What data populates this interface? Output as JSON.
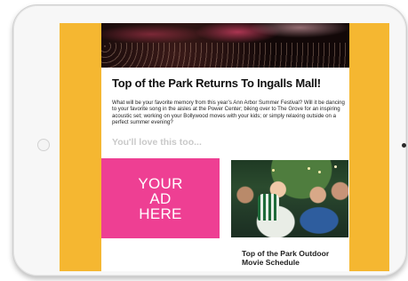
{
  "article": {
    "headline": "Top of the Park Returns To Ingalls Mall!",
    "intro": "What will be your favorite memory from this year’s Ann Arbor Summer Festival? Will it be dancing to your favorite song in the aisles at the Power Center; biking over to The Grove for an inspiring acoustic set; working on your Bollywood moves with your kids; or simply relaxing outside on a perfect summer evening?",
    "subhead": "You'll love this too..."
  },
  "ad": {
    "text": "YOUR\nAD\nHERE",
    "color": "#ee3f93"
  },
  "feature": {
    "caption": "Top of the Park Outdoor Movie Schedule"
  },
  "colors": {
    "background": "#f5b731",
    "content": "#ffffff",
    "subhead": "#c9c9c9"
  }
}
